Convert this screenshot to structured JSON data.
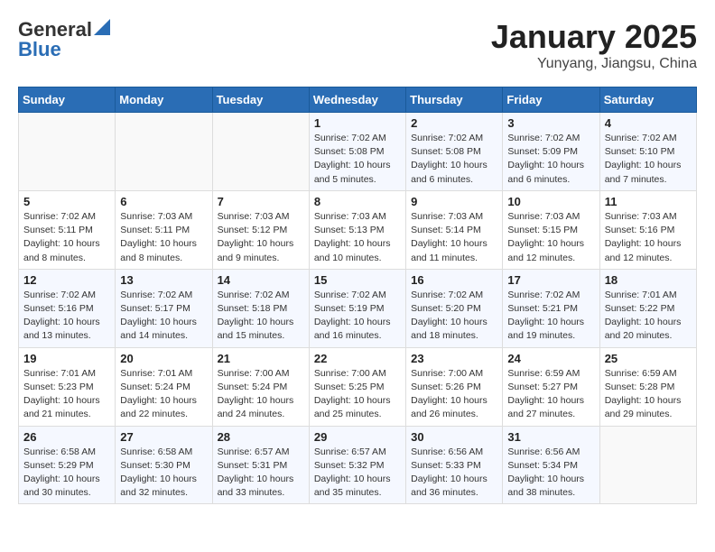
{
  "header": {
    "logo_line1": "General",
    "logo_line2": "Blue",
    "month": "January 2025",
    "location": "Yunyang, Jiangsu, China"
  },
  "days_of_week": [
    "Sunday",
    "Monday",
    "Tuesday",
    "Wednesday",
    "Thursday",
    "Friday",
    "Saturday"
  ],
  "weeks": [
    [
      {
        "day": "",
        "info": ""
      },
      {
        "day": "",
        "info": ""
      },
      {
        "day": "",
        "info": ""
      },
      {
        "day": "1",
        "info": "Sunrise: 7:02 AM\nSunset: 5:08 PM\nDaylight: 10 hours\nand 5 minutes."
      },
      {
        "day": "2",
        "info": "Sunrise: 7:02 AM\nSunset: 5:08 PM\nDaylight: 10 hours\nand 6 minutes."
      },
      {
        "day": "3",
        "info": "Sunrise: 7:02 AM\nSunset: 5:09 PM\nDaylight: 10 hours\nand 6 minutes."
      },
      {
        "day": "4",
        "info": "Sunrise: 7:02 AM\nSunset: 5:10 PM\nDaylight: 10 hours\nand 7 minutes."
      }
    ],
    [
      {
        "day": "5",
        "info": "Sunrise: 7:02 AM\nSunset: 5:11 PM\nDaylight: 10 hours\nand 8 minutes."
      },
      {
        "day": "6",
        "info": "Sunrise: 7:03 AM\nSunset: 5:11 PM\nDaylight: 10 hours\nand 8 minutes."
      },
      {
        "day": "7",
        "info": "Sunrise: 7:03 AM\nSunset: 5:12 PM\nDaylight: 10 hours\nand 9 minutes."
      },
      {
        "day": "8",
        "info": "Sunrise: 7:03 AM\nSunset: 5:13 PM\nDaylight: 10 hours\nand 10 minutes."
      },
      {
        "day": "9",
        "info": "Sunrise: 7:03 AM\nSunset: 5:14 PM\nDaylight: 10 hours\nand 11 minutes."
      },
      {
        "day": "10",
        "info": "Sunrise: 7:03 AM\nSunset: 5:15 PM\nDaylight: 10 hours\nand 12 minutes."
      },
      {
        "day": "11",
        "info": "Sunrise: 7:03 AM\nSunset: 5:16 PM\nDaylight: 10 hours\nand 12 minutes."
      }
    ],
    [
      {
        "day": "12",
        "info": "Sunrise: 7:02 AM\nSunset: 5:16 PM\nDaylight: 10 hours\nand 13 minutes."
      },
      {
        "day": "13",
        "info": "Sunrise: 7:02 AM\nSunset: 5:17 PM\nDaylight: 10 hours\nand 14 minutes."
      },
      {
        "day": "14",
        "info": "Sunrise: 7:02 AM\nSunset: 5:18 PM\nDaylight: 10 hours\nand 15 minutes."
      },
      {
        "day": "15",
        "info": "Sunrise: 7:02 AM\nSunset: 5:19 PM\nDaylight: 10 hours\nand 16 minutes."
      },
      {
        "day": "16",
        "info": "Sunrise: 7:02 AM\nSunset: 5:20 PM\nDaylight: 10 hours\nand 18 minutes."
      },
      {
        "day": "17",
        "info": "Sunrise: 7:02 AM\nSunset: 5:21 PM\nDaylight: 10 hours\nand 19 minutes."
      },
      {
        "day": "18",
        "info": "Sunrise: 7:01 AM\nSunset: 5:22 PM\nDaylight: 10 hours\nand 20 minutes."
      }
    ],
    [
      {
        "day": "19",
        "info": "Sunrise: 7:01 AM\nSunset: 5:23 PM\nDaylight: 10 hours\nand 21 minutes."
      },
      {
        "day": "20",
        "info": "Sunrise: 7:01 AM\nSunset: 5:24 PM\nDaylight: 10 hours\nand 22 minutes."
      },
      {
        "day": "21",
        "info": "Sunrise: 7:00 AM\nSunset: 5:24 PM\nDaylight: 10 hours\nand 24 minutes."
      },
      {
        "day": "22",
        "info": "Sunrise: 7:00 AM\nSunset: 5:25 PM\nDaylight: 10 hours\nand 25 minutes."
      },
      {
        "day": "23",
        "info": "Sunrise: 7:00 AM\nSunset: 5:26 PM\nDaylight: 10 hours\nand 26 minutes."
      },
      {
        "day": "24",
        "info": "Sunrise: 6:59 AM\nSunset: 5:27 PM\nDaylight: 10 hours\nand 27 minutes."
      },
      {
        "day": "25",
        "info": "Sunrise: 6:59 AM\nSunset: 5:28 PM\nDaylight: 10 hours\nand 29 minutes."
      }
    ],
    [
      {
        "day": "26",
        "info": "Sunrise: 6:58 AM\nSunset: 5:29 PM\nDaylight: 10 hours\nand 30 minutes."
      },
      {
        "day": "27",
        "info": "Sunrise: 6:58 AM\nSunset: 5:30 PM\nDaylight: 10 hours\nand 32 minutes."
      },
      {
        "day": "28",
        "info": "Sunrise: 6:57 AM\nSunset: 5:31 PM\nDaylight: 10 hours\nand 33 minutes."
      },
      {
        "day": "29",
        "info": "Sunrise: 6:57 AM\nSunset: 5:32 PM\nDaylight: 10 hours\nand 35 minutes."
      },
      {
        "day": "30",
        "info": "Sunrise: 6:56 AM\nSunset: 5:33 PM\nDaylight: 10 hours\nand 36 minutes."
      },
      {
        "day": "31",
        "info": "Sunrise: 6:56 AM\nSunset: 5:34 PM\nDaylight: 10 hours\nand 38 minutes."
      },
      {
        "day": "",
        "info": ""
      }
    ]
  ]
}
